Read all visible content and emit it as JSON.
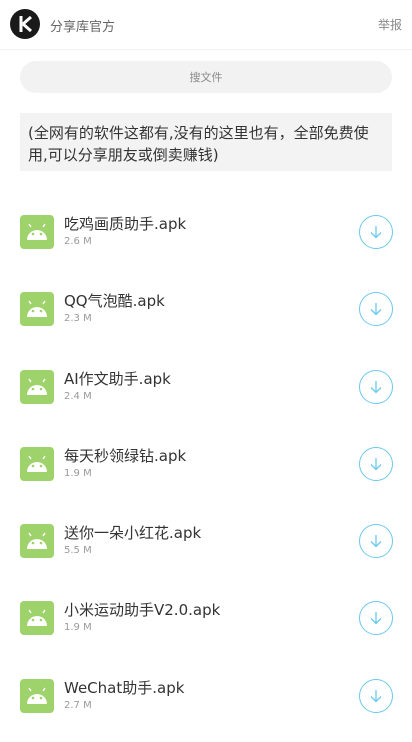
{
  "header": {
    "site_name": "分享库官方",
    "report_label": "举报"
  },
  "search": {
    "placeholder": "搜文件"
  },
  "notice": {
    "text": "(全网有的软件这都有,没有的这里也有，全部免费使用,可以分享朋友或倒卖赚钱)"
  },
  "files": [
    {
      "name": "吃鸡画质助手.apk",
      "size": "2.6 M"
    },
    {
      "name": "QQ气泡酷.apk",
      "size": "2.3 M"
    },
    {
      "name": "AI作文助手.apk",
      "size": "2.4 M"
    },
    {
      "name": "每天秒领绿钻.apk",
      "size": "1.9 M"
    },
    {
      "name": "送你一朵小红花.apk",
      "size": "5.5 M"
    },
    {
      "name": "小米运动助手V2.0.apk",
      "size": "1.9 M"
    },
    {
      "name": "WeChat助手.apk",
      "size": "2.7 M"
    }
  ],
  "colors": {
    "android_green": "#9ed26a",
    "download_blue": "#6cc8ee"
  },
  "icons": {
    "logo": "k-logo-icon",
    "app": "android-icon",
    "download": "download-arrow-icon"
  }
}
